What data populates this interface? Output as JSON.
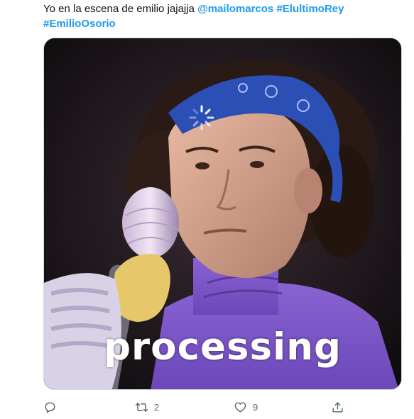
{
  "tweet": {
    "text_plain": "Yo en la escena de emilio jajajja",
    "mention": "@mailomarcos",
    "hashtag_1": "#ElultimoRey",
    "hashtag_2": "#EmilioOsorio"
  },
  "media": {
    "caption": "processing",
    "accent_color": "#8a63d2"
  },
  "actions": {
    "reply_icon": "reply-icon",
    "retweet_icon": "retweet-icon",
    "retweet_count": "2",
    "like_icon": "heart-icon",
    "like_count": "9",
    "share_icon": "share-icon"
  },
  "colors": {
    "link": "#1d9bf0",
    "text": "#0f1419",
    "muted": "#536471"
  }
}
